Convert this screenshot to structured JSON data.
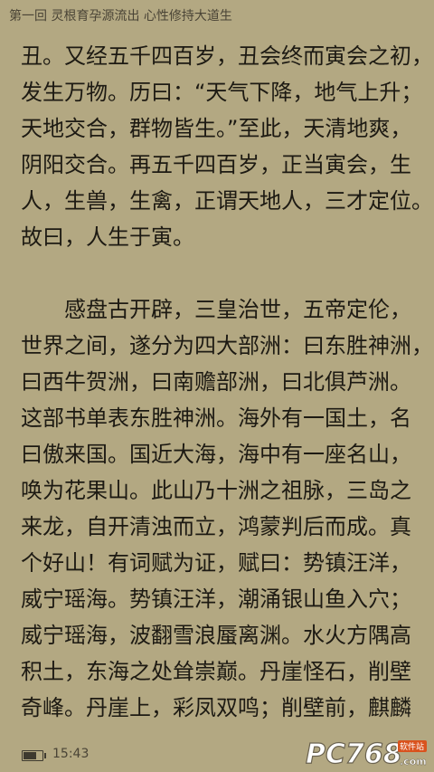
{
  "header": {
    "chapter_title": "第一回 灵根育孕源流出 心性修持大道生"
  },
  "paragraphs": [
    {
      "lines": [
        "丑。又经五千四百岁，丑会终而寅会之初，",
        "发生万物。历曰：“天气下降，地气上升；",
        "天地交合，群物皆生。”至此，天清地爽，",
        "阴阳交合。再五千四百岁，正当寅会，生",
        "人，生兽，生禽，正谓天地人，三才定位。",
        "故曰，人生于寅。"
      ]
    },
    {
      "lines": [
        "　　感盘古开辟，三皇治世，五帝定伦，",
        "世界之间，遂分为四大部洲：曰东胜神洲，",
        "曰西牛贺洲，曰南赡部洲，曰北俱芦洲。",
        "这部书单表东胜神洲。海外有一国土，名",
        "曰傲来国。国近大海，海中有一座名山，",
        "唤为花果山。此山乃十洲之祖脉，三岛之",
        "来龙，自开清浊而立，鸿蒙判后而成。真",
        "个好山！有词赋为证，赋曰：势镇汪洋，",
        "威宁瑶海。势镇汪洋，潮涌银山鱼入穴；",
        "威宁瑶海，波翻雪浪蜃离渊。水火方隅高",
        "积土，东海之处耸崇巅。丹崖怪石，削壁",
        "奇峰。丹崖上，彩凤双鸣；削壁前，麒麟"
      ]
    }
  ],
  "footer": {
    "battery_icon": "battery-icon",
    "time": "15:43",
    "watermark_text": "PC768",
    "watermark_sub": ".com",
    "watermark_badge": "软件站"
  },
  "colors": {
    "background": "#b3a882",
    "text": "#1d1a13",
    "header_text": "#4a4436"
  }
}
